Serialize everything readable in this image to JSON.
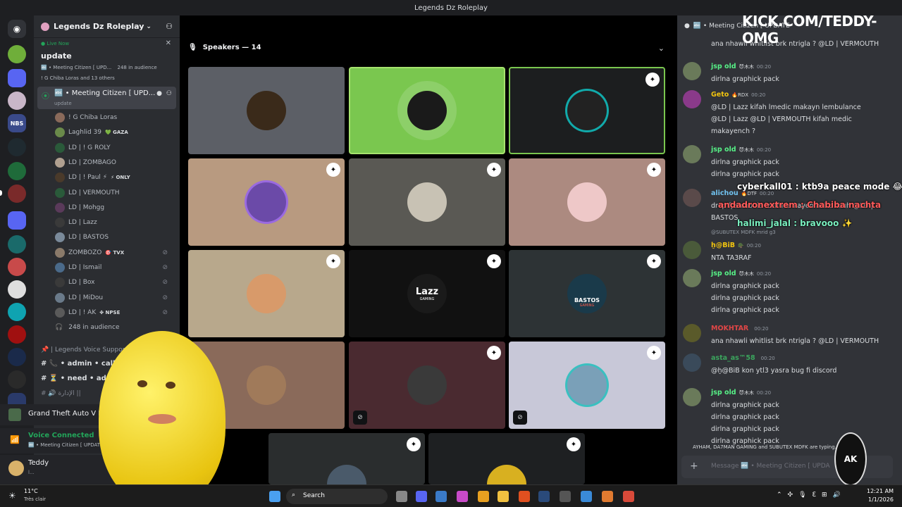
{
  "window": {
    "title": "Legends Dz Roleplay"
  },
  "server": {
    "name": "Legends Dz Roleplay"
  },
  "event": {
    "live": "Live Now",
    "title": "update",
    "line1": "🔤 • Meeting Citizen [ UPD...",
    "audience": "248 in audience",
    "line2": "! G Chiba Loras and 13 others"
  },
  "channel": {
    "name": "🔤 • Meeting Citizen [ UPD...",
    "sub": "update"
  },
  "participants": [
    {
      "name": "! G  Chiba Loras",
      "badge": "",
      "muted": false
    },
    {
      "name": "Laghlid 39",
      "badge": "💚 GAZA",
      "muted": false
    },
    {
      "name": "LD | ! G ROLY",
      "badge": "",
      "muted": false
    },
    {
      "name": "LD | ZOMBAGO",
      "badge": "",
      "muted": false
    },
    {
      "name": "LD | ! Paul ⚡",
      "badge": "⚡ ONLY",
      "muted": false
    },
    {
      "name": "LD | VERMOUTH",
      "badge": "",
      "muted": false
    },
    {
      "name": "LD | Mohgg",
      "badge": "",
      "muted": false
    },
    {
      "name": "LD | Lazz",
      "badge": "",
      "muted": false
    },
    {
      "name": "LD | BASTOS",
      "badge": "",
      "muted": false
    },
    {
      "name": "ZOMBOZO",
      "badge": "🎯 TVX",
      "muted": true
    },
    {
      "name": "LD | Ismail",
      "badge": "",
      "muted": true
    },
    {
      "name": "LD | Box",
      "badge": "",
      "muted": true
    },
    {
      "name": "LD | MiDou",
      "badge": "",
      "muted": true
    },
    {
      "name": "LD | ! AK",
      "badge": "✤ NPSE",
      "muted": true
    }
  ],
  "audience_row": "248 in audience",
  "other_channels": [
    {
      "name": "| Legends Voice Support :"
    },
    {
      "name": "• admin • call"
    },
    {
      "name": "• need • adm"
    },
    {
      "name": "الإدارة ||"
    }
  ],
  "activity": {
    "game": "Grand Theft Auto V Le"
  },
  "voice": {
    "status": "Voice Connected",
    "channel": "🔤 • Meeting Citizen [ UPDAT"
  },
  "user": {
    "name": "Teddy",
    "status": "l..."
  },
  "speakers": {
    "label": "Speakers — 14"
  },
  "tile_text": {
    "lazz": "Lazz",
    "lazz_sub": "GAMING",
    "bastos": "BASTOS",
    "bastos_sub": "GAMING"
  },
  "chat": {
    "header": "🔤 • Meeting Citizen [ UPDATE",
    "messages": [
      {
        "user": "",
        "time": "",
        "lines": [
          "ana nhawli whitlist brk ntrigla ? @LD | VERMOUTH"
        ]
      },
      {
        "user": "jsp old",
        "tag": "😈木木",
        "time": "00:20",
        "lines": [
          "dirlna graphick pack"
        ]
      },
      {
        "user": "Geto",
        "tag": "🔥RDX",
        "time": "00:20",
        "lines": [
          "@LD | Lazz kifah lmedic makayn lembulance",
          "@LD | Lazz @LD | VERMOUTH kifah medic",
          "makayench ?"
        ]
      },
      {
        "user": "jsp old",
        "tag": "😈木木",
        "time": "00:20",
        "lines": [
          "dirlna graphick pack",
          "dirlna graphick pack"
        ]
      },
      {
        "user": "alichou",
        "tag": "🔥DTF",
        "time": "00:20",
        "lines": [
          "drop fps chouia lzeff ida kayen hal ciriouh @LD |",
          "BASTOS"
        ]
      },
      {
        "user": "",
        "time": "",
        "lines": [
          "@SUBUTEX MDFK  mrid g3"
        ]
      },
      {
        "user": "ḫ@BiB",
        "tag": "🪖",
        "time": "00:20",
        "lines": [
          "NTA TA3RAF"
        ]
      },
      {
        "user": "jsp old",
        "tag": "😈木木",
        "time": "00:20",
        "lines": [
          "dirlna graphick pack",
          "dirlna graphick pack",
          "dirlna graphick pack"
        ]
      },
      {
        "user": "MOKHTAR",
        "tag": "",
        "time": "00:20",
        "lines": [
          "ana nhawli whitlist brk ntrigla ? @LD | VERMOUTH"
        ]
      },
      {
        "user": "asta_as™58",
        "tag": "",
        "time": "00:20",
        "lines": [
          "@ḫ@BiB kon ytl3 yasra bug fi discord"
        ]
      },
      {
        "user": "jsp old",
        "tag": "😈木木",
        "time": "00:20",
        "lines": [
          "dirlna graphick pack",
          "dirlna graphick pack",
          "dirlna graphick pack",
          "dirlna graphick pack"
        ]
      }
    ],
    "typing": "AYHAM, DA7MAN GAMING and SUBUTEX MDFK are typing...",
    "placeholder": "Message 🔤 • Meeting Citizen [ UPDA"
  },
  "overlay": {
    "kick": "KICK.COM/TEDDY-OMG",
    "c1": "cyberkall01 : ktb9a peace mode 😂",
    "c2": "andadronextrem : Chabiba nachta",
    "c3": "halimi_jalal : bravooo ✨",
    "logo": "AK"
  },
  "taskbar": {
    "weather_temp": "11°C",
    "weather_desc": "Très clair",
    "search": "Search",
    "time": "12:21 AM",
    "date": "1/1/2026"
  },
  "colors": {
    "accent": "#5865f2",
    "green": "#23a55a",
    "speakingTile": "#7ac74f",
    "jspname": "#57f287",
    "getoname": "#f1c40f",
    "alichou": "#71c3f0",
    "mokhtar": "#e04646"
  }
}
